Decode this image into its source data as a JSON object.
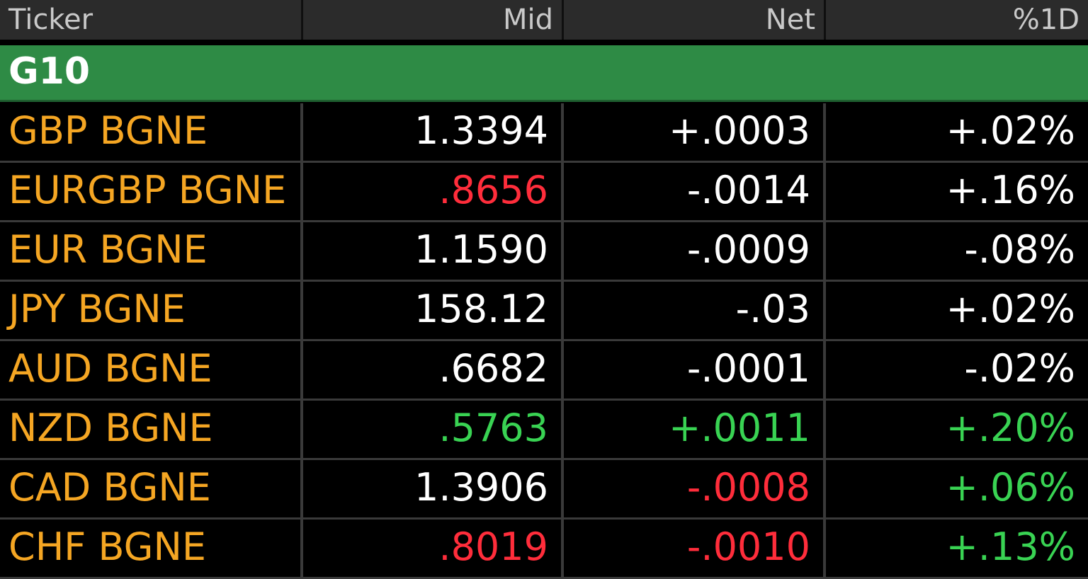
{
  "columns": {
    "ticker": "Ticker",
    "mid": "Mid",
    "net": "Net",
    "pct": "%1D"
  },
  "group": {
    "label": "G10",
    "color": "#2e8b45"
  },
  "colors": {
    "ticker": "#f5a623",
    "neutral": "#ffffff",
    "up": "#39d353",
    "down": "#ff2d3b"
  },
  "rows": [
    {
      "ticker": "GBP BGNE",
      "mid": "1.3394",
      "net": "+.0003",
      "pct": "+.02%",
      "mid_color": "white",
      "net_color": "white",
      "pct_color": "white"
    },
    {
      "ticker": "EURGBP BGNE",
      "mid": ".8656",
      "net": "-.0014",
      "pct": "+.16%",
      "mid_color": "red",
      "net_color": "white",
      "pct_color": "white"
    },
    {
      "ticker": "EUR BGNE",
      "mid": "1.1590",
      "net": "-.0009",
      "pct": "-.08%",
      "mid_color": "white",
      "net_color": "white",
      "pct_color": "white"
    },
    {
      "ticker": "JPY BGNE",
      "mid": "158.12",
      "net": "-.03",
      "pct": "+.02%",
      "mid_color": "white",
      "net_color": "white",
      "pct_color": "white"
    },
    {
      "ticker": "AUD BGNE",
      "mid": ".6682",
      "net": "-.0001",
      "pct": "-.02%",
      "mid_color": "white",
      "net_color": "white",
      "pct_color": "white"
    },
    {
      "ticker": "NZD BGNE",
      "mid": ".5763",
      "net": "+.0011",
      "pct": "+.20%",
      "mid_color": "green",
      "net_color": "green",
      "pct_color": "green"
    },
    {
      "ticker": "CAD BGNE",
      "mid": "1.3906",
      "net": "-.0008",
      "pct": "+.06%",
      "mid_color": "white",
      "net_color": "red",
      "pct_color": "green"
    },
    {
      "ticker": "CHF BGNE",
      "mid": ".8019",
      "net": "-.0010",
      "pct": "+.13%",
      "mid_color": "red",
      "net_color": "red",
      "pct_color": "green"
    }
  ]
}
